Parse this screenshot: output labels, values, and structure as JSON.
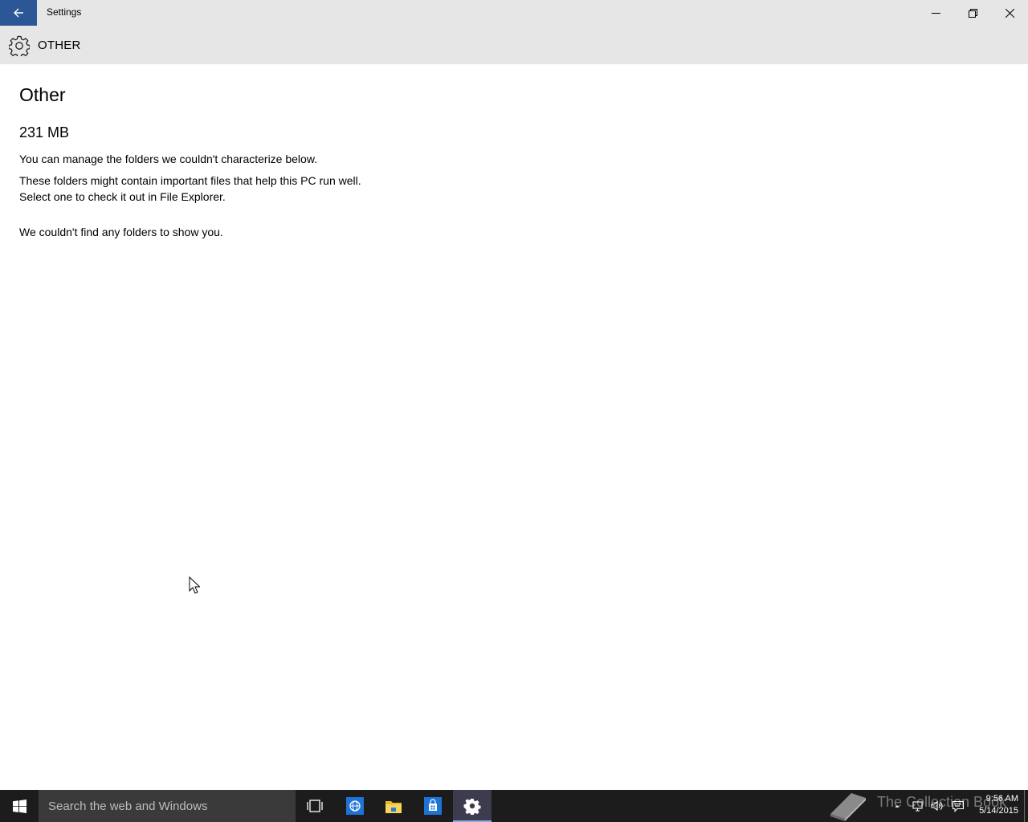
{
  "window": {
    "title": "Settings",
    "header": "OTHER"
  },
  "content": {
    "page_title": "Other",
    "size": "231 MB",
    "intro": "You can manage the folders we couldn't characterize below.",
    "description": "These folders might contain important files that help this PC run well. Select one to check it out in File Explorer.",
    "empty_message": "We couldn't find any folders to show you."
  },
  "taskbar": {
    "search_placeholder": "Search the web and Windows",
    "watermark": "The Collection Book",
    "clock_time": "9:56 AM",
    "clock_date": "5/14/2015",
    "icons": [
      "windows-start-icon",
      "task-view-icon",
      "internet-explorer-icon",
      "file-explorer-icon",
      "store-icon",
      "settings-gear-icon"
    ]
  },
  "colors": {
    "accent": "#2b5797",
    "titlebar": "#e6e6e6",
    "taskbar": "#1c1c1c",
    "search_box": "#3a3a3a"
  }
}
